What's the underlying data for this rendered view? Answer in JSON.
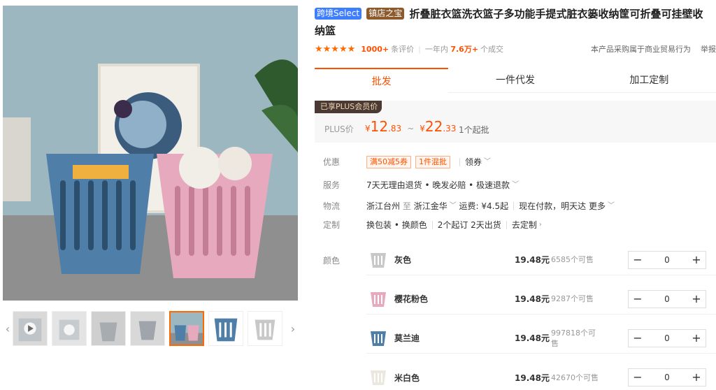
{
  "product": {
    "badge_select": "跨境Select",
    "badge_shop": "镇店之宝",
    "title": "折叠脏衣篮洗衣篮子多功能手提式脏衣篓收纳筐可折叠可挂壁收纳篮",
    "stars": "★★★★★",
    "review_count": "1000+",
    "review_label": "条评价",
    "year_label": "一年内",
    "sold": "7.6万+",
    "sold_label": "个成交",
    "trade_note": "本产品采购属于商业贸易行为",
    "report": "举报"
  },
  "tabs": [
    {
      "label": "批发",
      "active": true
    },
    {
      "label": "一件代发",
      "active": false
    },
    {
      "label": "加工定制",
      "active": false
    }
  ],
  "price": {
    "plus_tag": "已享PLUS会员价",
    "label": "PLUS价",
    "currency": "¥",
    "low_int": "12",
    "low_dec": ".83",
    "tilde": "~",
    "high_int": "22",
    "high_dec": ".33",
    "min_order": "1个起批"
  },
  "promo": {
    "label": "优惠",
    "coupon1": "满50减5券",
    "coupon2": "1件混批",
    "get_coupon": "领券"
  },
  "service": {
    "label": "服务",
    "text": "7天无理由退货 • 晚发必赔 • 极速退款"
  },
  "logistics": {
    "label": "物流",
    "from": "浙江台州",
    "to_word": "至",
    "to": "浙江金华",
    "shipping": "运费: ¥4.5起",
    "delivery": "现在付款，明天达",
    "more": "更多"
  },
  "custom": {
    "label": "定制",
    "options": "换包装 • 换颜色",
    "order": "2个起订 2天出货",
    "link": "去定制"
  },
  "sku": {
    "label": "颜色",
    "items": [
      {
        "name": "灰色",
        "price": "19.48元",
        "stock": "6585个可售",
        "qty": "0"
      },
      {
        "name": "樱花粉色",
        "price": "19.48元",
        "stock": "9287个可售",
        "qty": "0"
      },
      {
        "name": "莫兰迪",
        "price": "19.48元",
        "stock": "997818个可售",
        "qty": "0"
      },
      {
        "name": "米白色",
        "price": "19.48元",
        "stock": "42670个可售",
        "qty": "0"
      }
    ],
    "minus": "−",
    "plus": "+"
  },
  "gallery": {
    "arrow_left": "‹",
    "arrow_right": "›"
  },
  "colors": {
    "accent": "#ff5000",
    "basket_blue": "#4f7fa8",
    "basket_pink": "#e7a9bd",
    "basket_gray": "#c8c8c8",
    "basket_white": "#ece8df"
  }
}
